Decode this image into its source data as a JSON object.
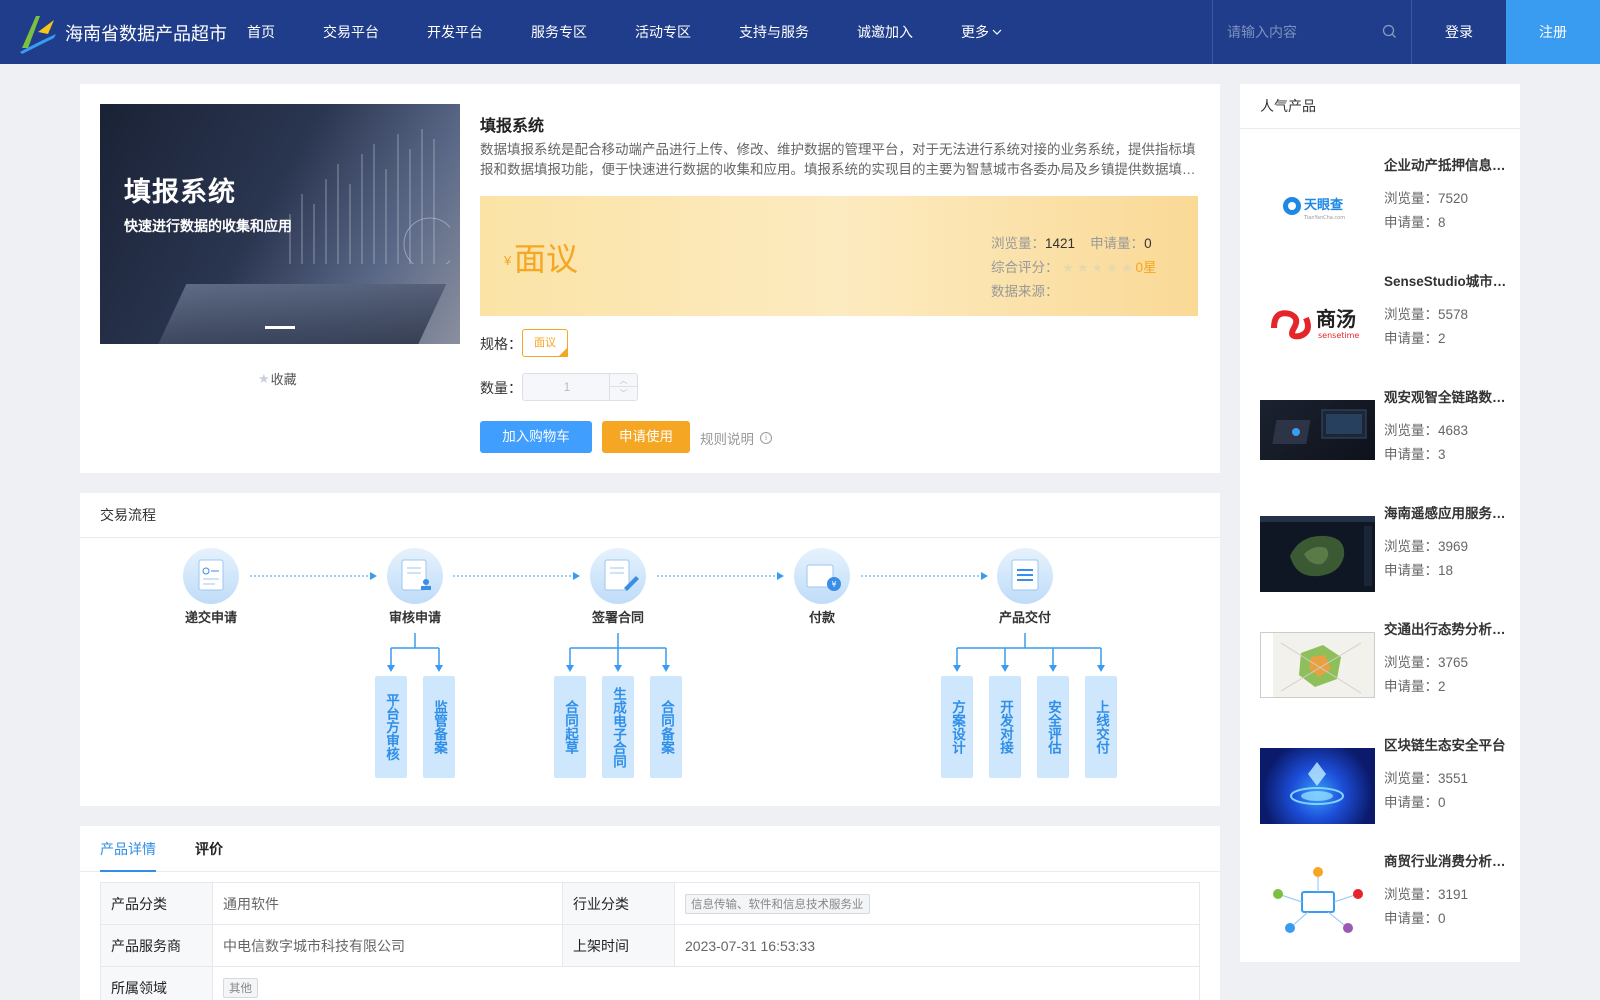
{
  "header": {
    "site_title": "海南省数据产品超市",
    "nav": [
      "首页",
      "交易平台",
      "开发平台",
      "服务专区",
      "活动专区",
      "支持与服务",
      "诚邀加入"
    ],
    "nav_more": "更多",
    "search_placeholder": "请输入内容",
    "login": "登录",
    "register": "注册",
    "colors": {
      "header_bg": "#1f3d8a",
      "register_bg": "#3a9cf0"
    }
  },
  "product": {
    "banner_title": "填报系统",
    "banner_subtitle": "快速进行数据的收集和应用",
    "favorite": "收藏",
    "title": "填报系统",
    "description": "数据填报系统是配合移动端产品进行上传、修改、维护数据的管理平台，对于无法进行系统对接的业务系统，提供指标填报和数据填报功能，便于快速进行数据的收集和应用。填报系统的实现目的主要为智慧城市各委办局及乡镇提供数据填报服务。",
    "currency_symbol": "¥",
    "price": "面议",
    "views_label": "浏览量：",
    "views": "1421",
    "applications_label": "申请量：",
    "applications": "0",
    "rating_label": "综合评分：",
    "rating_stars": "★★★★★",
    "rating": "0星",
    "source_label": "数据来源：",
    "spec_label": "规格：",
    "spec_value": "面议",
    "qty_label": "数量：",
    "qty_value": "1",
    "add_cart": "加入购物车",
    "apply": "申请使用",
    "rules": "规则说明",
    "colors": {
      "accent": "#f5a623",
      "primary": "#409eff"
    }
  },
  "flow": {
    "title": "交易流程",
    "steps": [
      "递交申请",
      "审核申请",
      "签署合同",
      "付款",
      "产品交付"
    ],
    "sub_steps": {
      "review": [
        "平台方审核",
        "监管备案"
      ],
      "contract": [
        "合同起草",
        "生成电子合同",
        "合同备案"
      ],
      "delivery": [
        "方案设计",
        "开发对接",
        "安全评估",
        "上线交付"
      ]
    }
  },
  "detail": {
    "tabs": [
      "产品详情",
      "评价"
    ],
    "rows": [
      {
        "k1": "产品分类",
        "v1": "通用软件",
        "k2": "行业分类",
        "v2": "信息传输、软件和信息技术服务业"
      },
      {
        "k1": "产品服务商",
        "v1": "中电信数字城市科技有限公司",
        "k2": "上架时间",
        "v2": "2023-07-31 16:53:33"
      },
      {
        "k1": "所属领域",
        "v1": "其他"
      }
    ]
  },
  "popular": {
    "title": "人气产品",
    "views_label": "浏览量：",
    "applications_label": "申请量：",
    "items": [
      {
        "name": "企业动产抵押信息查询",
        "views": "7520",
        "applications": "8",
        "icon": "tianyancha-logo"
      },
      {
        "name": "SenseStudio城市数据平台",
        "views": "5578",
        "applications": "2",
        "icon": "sensetime-logo"
      },
      {
        "name": "观安观智全链路数据安全",
        "views": "4683",
        "applications": "3",
        "icon": "device-photo"
      },
      {
        "name": "海南遥感应用服务平台",
        "views": "3969",
        "applications": "18",
        "icon": "satellite-map"
      },
      {
        "name": "交通出行态势分析系统",
        "views": "3765",
        "applications": "2",
        "icon": "traffic-map"
      },
      {
        "name": "区块链生态安全平台",
        "views": "3551",
        "applications": "0",
        "icon": "blockchain-art"
      },
      {
        "name": "商贸行业消费分析平台",
        "views": "3191",
        "applications": "0",
        "icon": "commerce-network"
      }
    ]
  }
}
